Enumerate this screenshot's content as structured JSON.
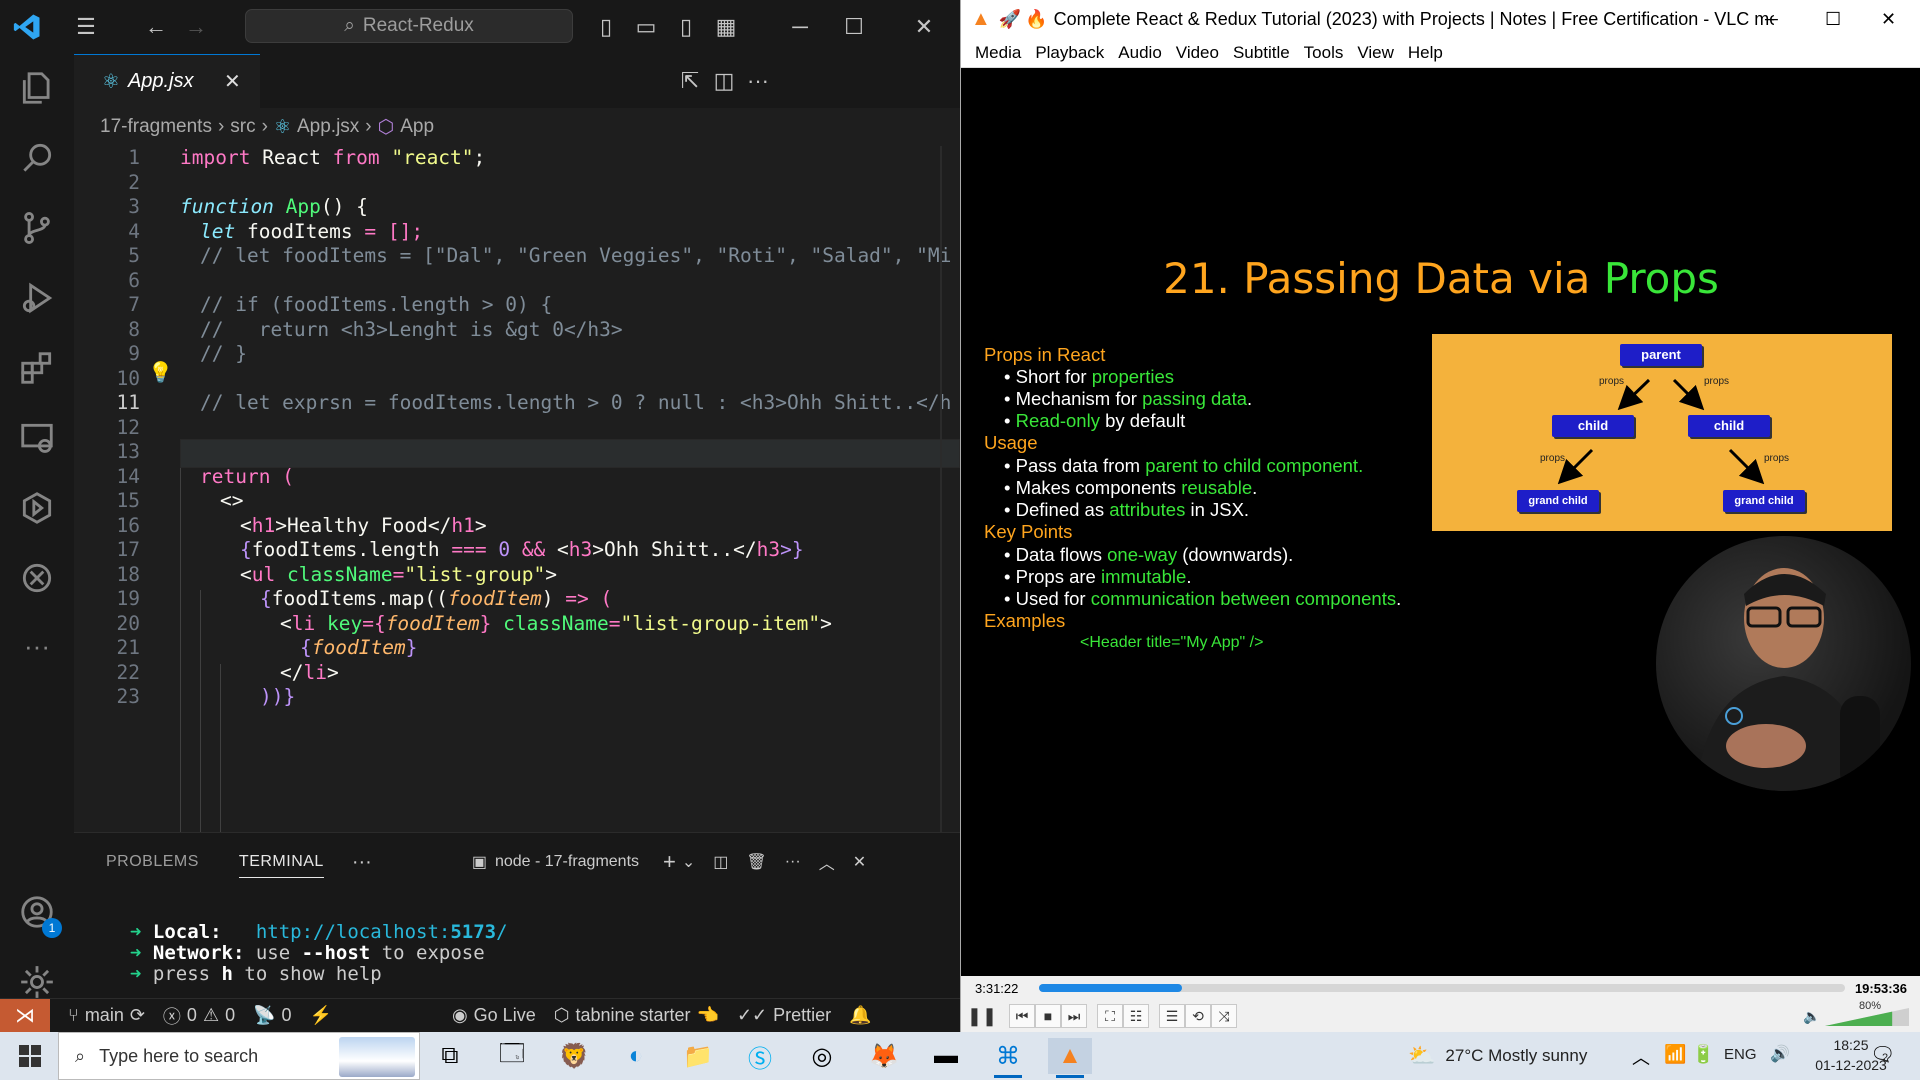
{
  "vscode": {
    "search_label": "React-Redux",
    "tab_label": "App.jsx",
    "breadcrumb": [
      "17-fragments",
      "src",
      "App.jsx",
      "App"
    ],
    "line_numbers": [
      "1",
      "2",
      "3",
      "4",
      "5",
      "6",
      "7",
      "8",
      "9",
      "10",
      "11",
      "12",
      "13",
      "14",
      "15",
      "16",
      "17",
      "18",
      "19",
      "20",
      "21",
      "22",
      "23"
    ],
    "code": {
      "l1_import": "import",
      "l1_react": " React ",
      "l1_from": "from",
      "l1_str": " \"react\"",
      "l1_semi": ";",
      "l3_function": "function",
      "l3_app": " App",
      "l3_rest": "() {",
      "l4_let": "let",
      "l4_name": " foodItems",
      "l4_rest": " = [];",
      "l5": "// let foodItems = [\"Dal\", \"Green Veggies\", \"Roti\", \"Salad\", \"Mi",
      "l7": "// if (foodItems.length > 0) {",
      "l8": "//   return <h3>Lenght is &gt 0</h3>",
      "l9": "// }",
      "l11": "// let exprsn = foodItems.length > 0 ? null : <h3>Ohh Shitt..</h",
      "l14_return": "return",
      "l14_paren": " (",
      "l15": "<>",
      "l16_open": "<",
      "l16_tag": "h1",
      "l16_text": ">Healthy Food</",
      "l16_tag2": "h1",
      "l16_close": ">",
      "l17_brace": "{",
      "l17_expr": "foodItems.length ",
      "l17_op": "===",
      "l17_num": " 0 ",
      "l17_and": "&&",
      "l17_lt": " <",
      "l17_tag": "h3",
      "l17_text": ">Ohh Shitt..</",
      "l17_tag2": "h3",
      "l17_end": ">}",
      "l18_open": "<",
      "l18_tag": "ul",
      "l18_attr": " className",
      "l18_eq": "=",
      "l18_val": "\"list-group\"",
      "l18_close": ">",
      "l19_brace": "{",
      "l19_expr": "foodItems.map((",
      "l19_param": "foodItem",
      "l19_rest": ") ",
      "l19_arrow": "=>",
      "l19_paren": " (",
      "l20_open": "<",
      "l20_tag": "li",
      "l20_key": " key",
      "l20_eq": "={",
      "l20_param": "foodItem",
      "l20_cb": "}",
      "l20_attr": " className",
      "l20_eq2": "=",
      "l20_val": "\"list-group-item\"",
      "l20_close": ">",
      "l21_ob": "{",
      "l21_param": "foodItem",
      "l21_cb": "}",
      "l22_open": "</",
      "l22_tag": "li",
      "l22_close": ">",
      "l23": "))}"
    },
    "panel": {
      "tab_problems": "PROBLEMS",
      "tab_terminal": "TERMINAL",
      "terminal_name": "node - 17-fragments",
      "lines": {
        "local_label": "Local:",
        "local_url": "http://localhost:",
        "local_port": "5173",
        "local_slash": "/",
        "network_label": "Network:",
        "network_use": " use ",
        "network_flag": "--host",
        "network_rest": " to expose",
        "help_press": "press ",
        "help_key": "h",
        "help_rest": " to show help"
      }
    },
    "status": {
      "branch": "main",
      "errors": "0",
      "warnings": "0",
      "ports": "0",
      "go_live": "Go Live",
      "tabnine": "tabnine starter",
      "prettier": "Prettier"
    },
    "accounts_badge": "1"
  },
  "vlc": {
    "title": "Complete React & Redux Tutorial (2023) with Projects | Notes | Free Certification - VLC me...",
    "menu": [
      "Media",
      "Playback",
      "Audio",
      "Video",
      "Subtitle",
      "Tools",
      "View",
      "Help"
    ],
    "time_elapsed": "3:31:22",
    "time_total": "19:53:36",
    "progress": 0.177,
    "volume_label": "80%",
    "volume": 0.8
  },
  "slide": {
    "title_main": "21. Passing Data via ",
    "title_accent": "Props",
    "props_heading": "Props in React",
    "b1_pre": "Short for ",
    "b1_hl": "properties",
    "b2_pre": "Mechanism for ",
    "b2_hl": "passing data",
    "b2_post": ".",
    "b3_hl": "Read-only",
    "b3_post": " by default",
    "usage_heading": "Usage",
    "u1_pre": "Pass data from ",
    "u1_hl": "parent to child component.",
    "u2_pre": "Makes components ",
    "u2_hl": "reusable",
    "u2_post": ".",
    "u3_pre": "Defined as ",
    "u3_hl": "attributes",
    "u3_post": " in JSX.",
    "key_heading": "Key Points",
    "k1_pre": "Data flows ",
    "k1_hl": "one-way",
    "k1_post": " (downwards).",
    "k2_pre": "Props are ",
    "k2_hl": "immutable",
    "k2_post": ".",
    "k3_pre": "Used for ",
    "k3_hl": "communication between components",
    "k3_post": ".",
    "examples_heading": "Examples",
    "example_code": "<Header title=\"My App\" />",
    "diagram": {
      "parent": "parent",
      "child": "child",
      "grand_child": "grand child",
      "props": "props"
    }
  },
  "taskbar": {
    "search_placeholder": "Type here to search",
    "weather": "27°C  Mostly sunny",
    "lang": "ENG",
    "time": "18:25",
    "date": "01-12-2023",
    "notif_count": "2"
  },
  "colors": {
    "vscode_accent": "#0078d4",
    "remote_badge": "#c55a32",
    "slide_orange": "#ffa51e",
    "slide_green": "#39e639",
    "vlc_progress": "#1e88e5"
  }
}
